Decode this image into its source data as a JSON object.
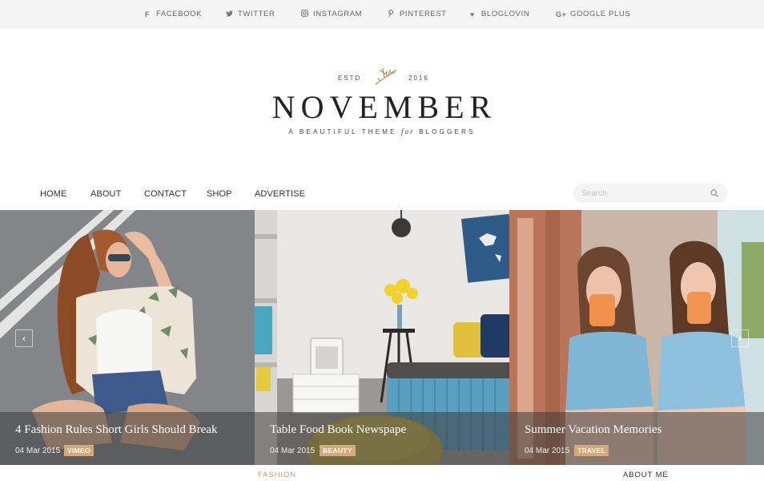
{
  "social": [
    {
      "icon": "facebook-icon",
      "glyph": "f",
      "label": "Facebook"
    },
    {
      "icon": "twitter-icon",
      "glyph": "🐦",
      "label": "Twitter"
    },
    {
      "icon": "instagram-icon",
      "glyph": "◎",
      "label": "Instagram"
    },
    {
      "icon": "pinterest-icon",
      "glyph": "℘",
      "label": "Pinterest"
    },
    {
      "icon": "heart-icon",
      "glyph": "♥",
      "label": "Bloglovin"
    },
    {
      "icon": "google-plus-icon",
      "glyph": "G+",
      "label": "Google Plus"
    }
  ],
  "logo": {
    "estd": "ESTD",
    "year": "2016",
    "brand": "NOVEMBER",
    "tagline_before": "A BEAUTIFUL THEME",
    "tagline_for": "for",
    "tagline_after": "BLOGGERS"
  },
  "nav": {
    "items": [
      "HOME",
      "ABOUT",
      "CONTACT",
      "SHOP",
      "ADVERTISE"
    ],
    "search_placeholder": "Search"
  },
  "slider": {
    "prev_glyph": "‹",
    "next_glyph": "›",
    "slides": [
      {
        "title": "4 Fashion Rules Short Girls Should Break",
        "date": "04 Mar 2015",
        "tag": "VIMEO"
      },
      {
        "title": "Table Food Book Newspape",
        "date": "04 Mar 2015",
        "tag": "BEAUTY"
      },
      {
        "title": "Summer Vacation Memories",
        "date": "04 Mar 2015",
        "tag": "TRAVEL"
      }
    ]
  },
  "bottom": {
    "fashion": "FASHION",
    "about_me": "ABOUT ME"
  },
  "colors": {
    "accent": "#d7a87a",
    "fashion_label": "#c9a07a",
    "topbar_bg": "#f5f5f5"
  }
}
